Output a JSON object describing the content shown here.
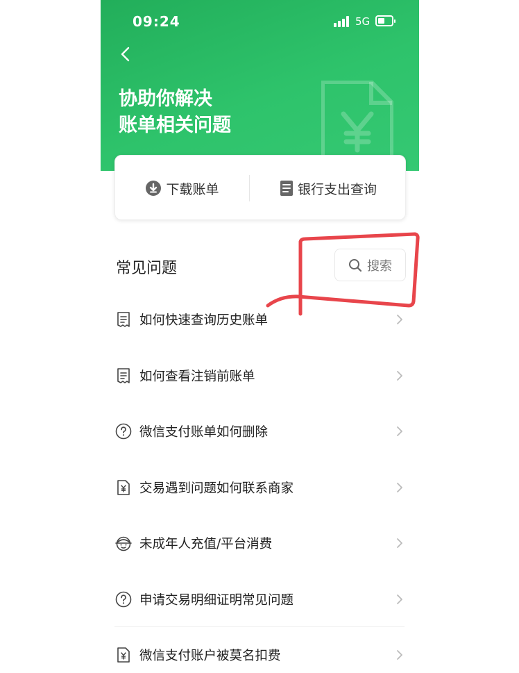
{
  "status_bar": {
    "time": "09:24",
    "network": "5G"
  },
  "header": {
    "title_line1": "协助你解决",
    "title_line2": "账单相关问题"
  },
  "quick_actions": {
    "download": {
      "label": "下载账单",
      "icon": "download-circle-icon"
    },
    "bank_query": {
      "label": "银行支出查询",
      "icon": "document-icon"
    }
  },
  "faq": {
    "title": "常见问题",
    "search_label": "搜索",
    "items": [
      {
        "label": "如何快速查询历史账单",
        "icon": "receipt-icon"
      },
      {
        "label": "如何查看注销前账单",
        "icon": "receipt-icon"
      },
      {
        "label": "微信支付账单如何删除",
        "icon": "question-circle-icon"
      },
      {
        "label": "交易遇到问题如何联系商家",
        "icon": "yen-doc-icon"
      },
      {
        "label": "未成年人充值/平台消费",
        "icon": "kid-face-icon"
      },
      {
        "label": "申请交易明细证明常见问题",
        "icon": "question-circle-icon"
      },
      {
        "label": "微信支付账户被莫名扣费",
        "icon": "yen-doc-icon"
      }
    ]
  },
  "colors": {
    "brand_green": "#2ec36b",
    "annotation_red": "#e8454b"
  }
}
